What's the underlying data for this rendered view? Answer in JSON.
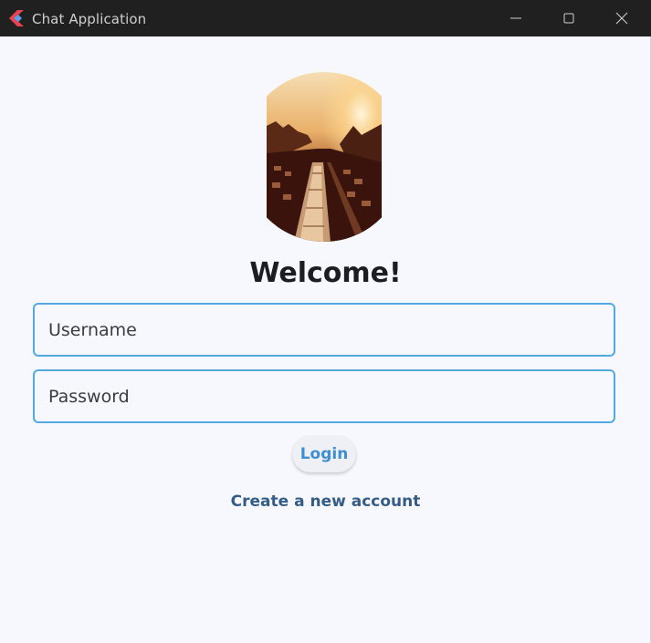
{
  "window": {
    "title": "Chat Application",
    "icon": "flutter-app-icon",
    "controls": [
      "minimize-icon",
      "maximize-icon",
      "close-icon"
    ]
  },
  "login": {
    "avatar_image": "city-sunset-photo",
    "heading": "Welcome!",
    "username_placeholder": "Username",
    "username_value": "",
    "password_placeholder": "Password",
    "password_value": "",
    "login_label": "Login",
    "create_account_label": "Create a new account"
  },
  "colors": {
    "titlebar": "#202020",
    "background": "#f7f8fd",
    "field_border": "#52a9e3",
    "login_text": "#3d8fd0",
    "link_text": "#355c87"
  }
}
